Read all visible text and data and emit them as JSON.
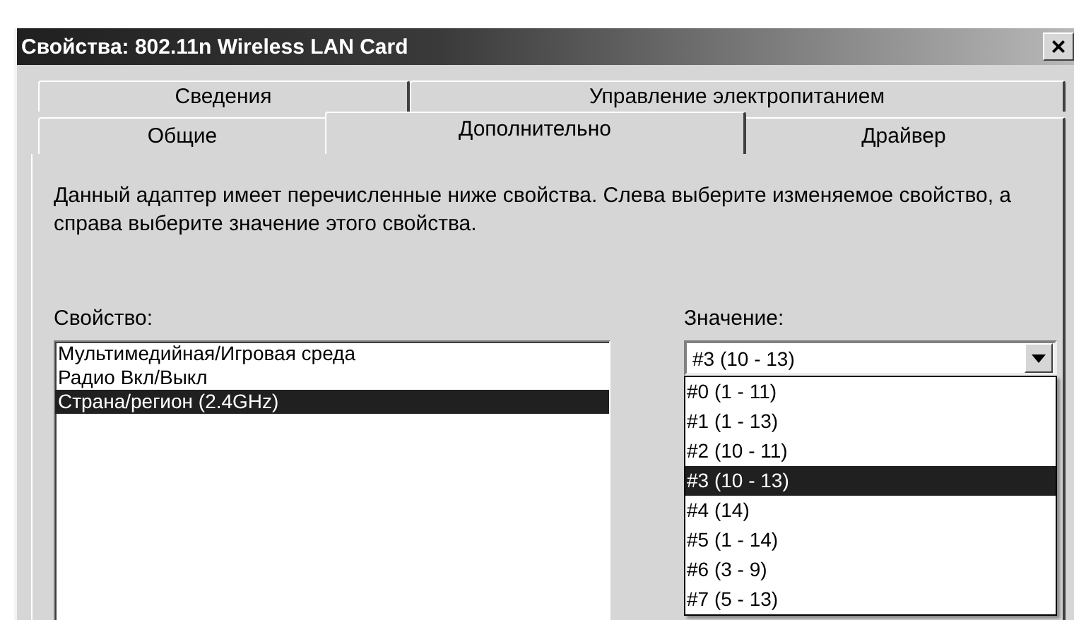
{
  "window": {
    "title": "Свойства: 802.11n Wireless LAN Card",
    "close": "×"
  },
  "tabs_back": [
    {
      "label": "Сведения",
      "selected": false
    },
    {
      "label": "Управление электропитанием",
      "selected": false
    }
  ],
  "tabs_front": [
    {
      "label": "Общие",
      "selected": false
    },
    {
      "label": "Дополнительно",
      "selected": true
    },
    {
      "label": "Драйвер",
      "selected": false
    }
  ],
  "description": "Данный адаптер имеет перечисленные ниже свойства. Слева выберите изменяемое свойство, а справа выберите значение этого свойства.",
  "property": {
    "label": "Свойство:",
    "items": [
      {
        "label": "Мультимедийная/Игровая среда",
        "selected": false
      },
      {
        "label": "Радио Вкл/Выкл",
        "selected": false
      },
      {
        "label": "Страна/регион (2.4GHz)",
        "selected": true
      }
    ]
  },
  "value": {
    "label": "Значение:",
    "current": "#3 (10 - 13)",
    "options": [
      {
        "label": "#0 (1 - 11)",
        "selected": false
      },
      {
        "label": "#1 (1 - 13)",
        "selected": false
      },
      {
        "label": "#2 (10 - 11)",
        "selected": false
      },
      {
        "label": "#3 (10 - 13)",
        "selected": true
      },
      {
        "label": "#4 (14)",
        "selected": false
      },
      {
        "label": "#5 (1 - 14)",
        "selected": false
      },
      {
        "label": "#6 (3 - 9)",
        "selected": false
      },
      {
        "label": "#7 (5 - 13)",
        "selected": false
      }
    ]
  }
}
